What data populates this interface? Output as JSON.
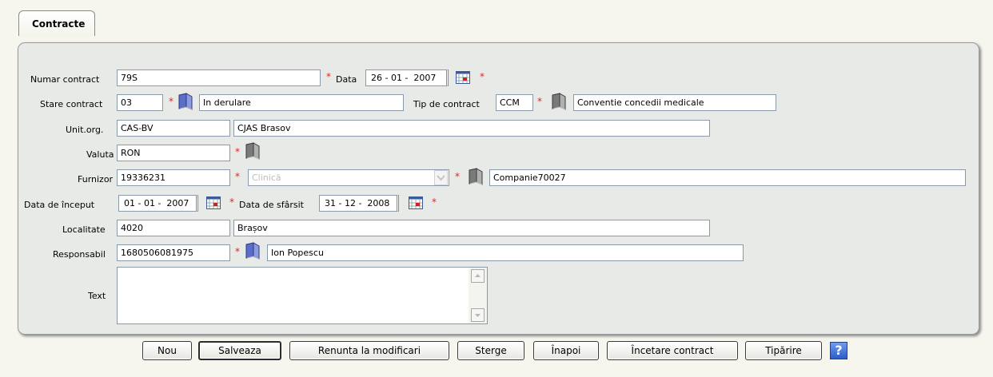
{
  "tab": {
    "label": "Contracte"
  },
  "form": {
    "numar_contract": {
      "label": "Numar contract",
      "value": "79S"
    },
    "data": {
      "label": "Data",
      "value": "26 - 01 -  2007"
    },
    "stare_contract": {
      "label": "Stare contract",
      "code": "03",
      "name": "In derulare"
    },
    "tip_contract": {
      "label": "Tip de contract",
      "code": "CCM",
      "name": "Conventie concedii medicale"
    },
    "unit_org": {
      "label": "Unit.org.",
      "code": "CAS-BV",
      "name": "CJAS Brasov"
    },
    "valuta": {
      "label": "Valuta",
      "value": "RON"
    },
    "furnizor": {
      "label": "Furnizor",
      "code": "19336231",
      "type": "Clinică",
      "name": "Companie70027"
    },
    "data_inceput": {
      "label": "Data de început",
      "value": "01 - 01 -  2007"
    },
    "data_sfarsit": {
      "label": "Data de sfârsit",
      "value": "31 - 12 -  2008"
    },
    "localitate": {
      "label": "Localitate",
      "code": "4020",
      "name": "Brașov"
    },
    "responsabil": {
      "label": "Responsabil",
      "code": "1680506081975",
      "name": "Ion Popescu"
    },
    "text": {
      "label": "Text",
      "value": ""
    },
    "required_mark": "*"
  },
  "buttons": {
    "nou": "Nou",
    "salveaza": "Salveaza",
    "renunta": "Renunta la modificari",
    "sterge": "Sterge",
    "inapoi": "Înapoi",
    "incetare": "Încetare contract",
    "tiparire": "Tipărire",
    "help": "?"
  },
  "colors": {
    "required": "#e8211e",
    "panel": "#e8eae8",
    "page": "#f6f6ef",
    "help": "#2c5cc8"
  }
}
